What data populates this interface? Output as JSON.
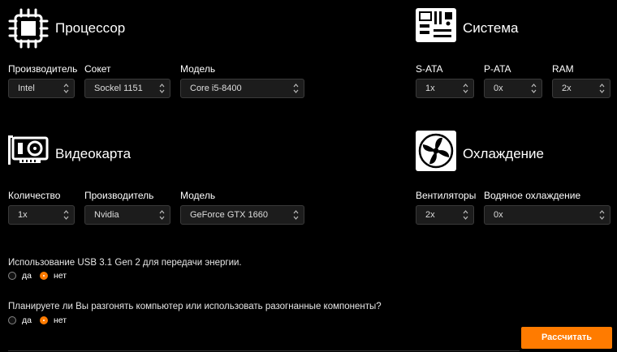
{
  "sections": {
    "cpu": {
      "title": "Процессор",
      "icon": "cpu-icon"
    },
    "system": {
      "title": "Система",
      "icon": "motherboard-icon"
    },
    "gpu": {
      "title": "Видеокарта",
      "icon": "graphics-card-icon"
    },
    "cooling": {
      "title": "Охлаждение",
      "icon": "fan-icon"
    }
  },
  "cpu_fields": [
    {
      "label": "Производитель",
      "value": "Intel"
    },
    {
      "label": "Сокет",
      "value": "Sockel 1151"
    },
    {
      "label": "Модель",
      "value": "Core i5-8400"
    }
  ],
  "system_fields": [
    {
      "label": "S-ATA",
      "value": "1x"
    },
    {
      "label": "P-ATA",
      "value": "0x"
    },
    {
      "label": "RAM",
      "value": "2x"
    }
  ],
  "gpu_fields": [
    {
      "label": "Количество",
      "value": "1x"
    },
    {
      "label": "Производитель",
      "value": "Nvidia"
    },
    {
      "label": "Модель",
      "value": "GeForce GTX 1660"
    }
  ],
  "cooling_fields": [
    {
      "label": "Вентиляторы",
      "value": "2x"
    },
    {
      "label": "Водяное охлаждение",
      "value": "0x"
    }
  ],
  "questions": [
    {
      "text": "Использование USB 3.1 Gen 2 для передачи энергии.",
      "options": [
        "да",
        "нет"
      ],
      "selected": "нет"
    },
    {
      "text": "Планируете ли Вы разгонять компьютер или использовать разогнанные компоненты?",
      "options": [
        "да",
        "нет"
      ],
      "selected": "нет"
    }
  ],
  "submit_label": "Рассчитать",
  "colors": {
    "accent": "#ff7b00",
    "background": "#000000"
  }
}
